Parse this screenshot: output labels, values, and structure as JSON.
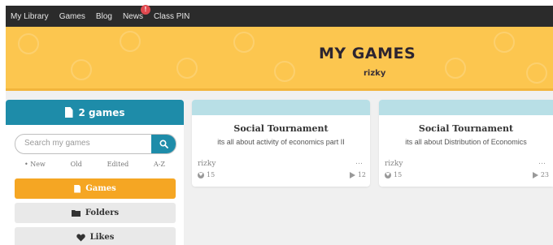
{
  "topbar": {
    "items": [
      {
        "label": "My Library"
      },
      {
        "label": "Games"
      },
      {
        "label": "Blog"
      },
      {
        "label": "News",
        "badge": "!"
      },
      {
        "label": "Class PIN"
      }
    ]
  },
  "banner": {
    "title": "MY GAMES",
    "subtitle": "rizky"
  },
  "sidebar": {
    "header": "2 games",
    "search_placeholder": "Search my games",
    "sort": [
      "• New",
      "Old",
      "Edited",
      "A-Z"
    ],
    "buttons": [
      {
        "label": "Games",
        "icon": "document-icon"
      },
      {
        "label": "Folders",
        "icon": "folder-icon"
      },
      {
        "label": "Likes",
        "icon": "heart-icon"
      }
    ]
  },
  "games": [
    {
      "title": "Social Tournament",
      "description": "its all about activity of economics part II",
      "author": "rizky",
      "likes": "15",
      "plays": "12"
    },
    {
      "title": "Social Tournament",
      "description": "its all about Distribution of Economics",
      "author": "rizky",
      "likes": "15",
      "plays": "23"
    }
  ],
  "colors": {
    "topbar": "#2b2b2b",
    "banner": "#fcc64f",
    "sidebar_header": "#1e8ca9",
    "active_button": "#f5a623",
    "card_cap": "#b8dfe6"
  }
}
